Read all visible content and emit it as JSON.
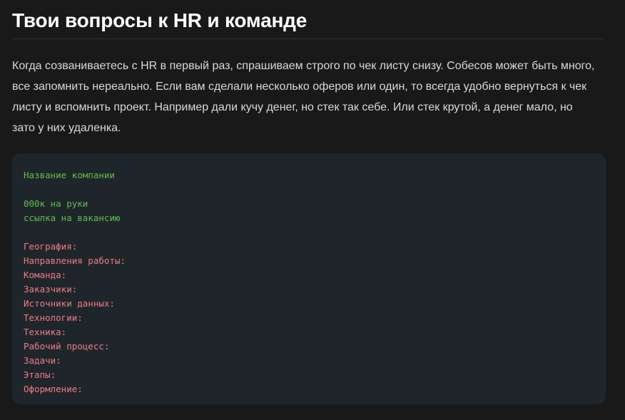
{
  "heading": {
    "title": "Твои вопросы к HR и команде"
  },
  "intro": {
    "text": "Когда созваниваетесь с HR в первый раз, спрашиваем строго по чек листу снизу. Собесов может быть много, все запомнить нереально. Если вам сделали несколько оферов или один, то всегда удобно вернуться к чек листу и вспомнить проект. Например дали кучу денег, но стек так себе. Или стек крутой, а денег мало, но зато у них удаленка."
  },
  "code": {
    "company": "Название компании",
    "salary": "000к на руки",
    "vacancy_link": "ссылка на вакансию",
    "fields": [
      "География:",
      "Направления работы:",
      "Команда:",
      "Заказчики:",
      "Источники данных:",
      "Технологии:",
      "Техника:",
      "Рабочий процесс:",
      "Задачи:",
      "Этапы:",
      "Оформление:"
    ]
  },
  "colors": {
    "background": "#191919",
    "code_background": "#1f262b",
    "code_green": "#5fbf4a",
    "code_red": "#f07a84"
  }
}
